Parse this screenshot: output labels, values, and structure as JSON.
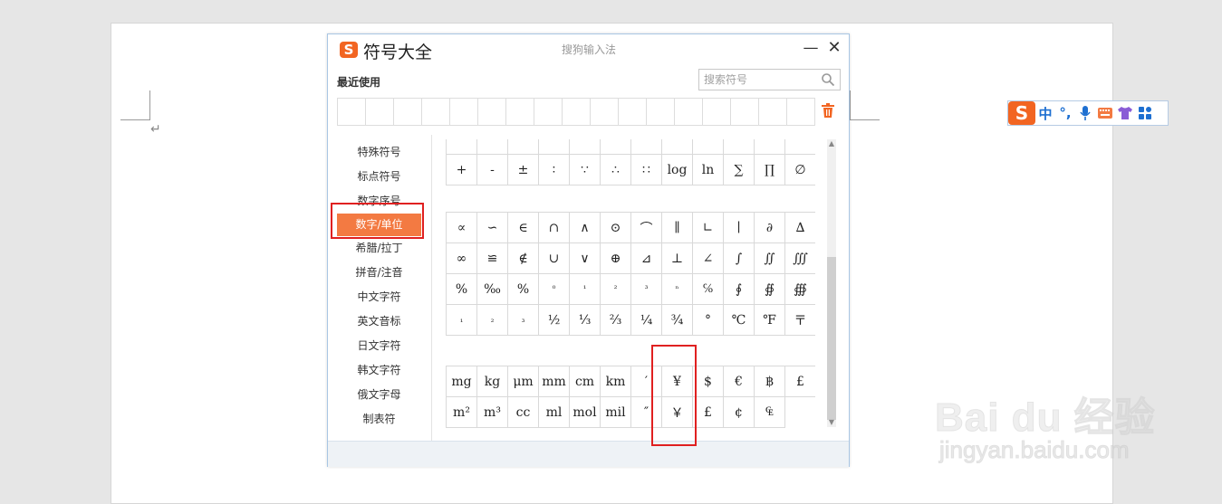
{
  "dialog": {
    "title": "符号大全",
    "subtitle": "搜狗输入法",
    "minimize": "—",
    "close": "✕",
    "recent_label": "最近使用",
    "search_placeholder": "搜索符号",
    "logo_char": "S"
  },
  "ime_bar": {
    "logo": "S",
    "items": [
      "中",
      "°,",
      "🎤",
      "⌨",
      "👕",
      "▦"
    ]
  },
  "para_mark": "↵",
  "categories": [
    "特殊符号",
    "标点符号",
    "数字序号",
    "数字/单位",
    "希腊/拉丁",
    "拼音/注音",
    "中文字符",
    "英文音标",
    "日文字符",
    "韩文字符",
    "俄文字母",
    "制表符"
  ],
  "active_category": "数字/单位",
  "grids": {
    "g0": [
      [
        "",
        "",
        "",
        "",
        "",
        "",
        "",
        "",
        "",
        "",
        "",
        ""
      ],
      [
        "+",
        "-",
        "±",
        "∶",
        "∵",
        "∴",
        "∷",
        "log",
        "ln",
        "∑",
        "∏",
        "∅"
      ]
    ],
    "g1": [
      [
        "∝",
        "∽",
        "∈",
        "∩",
        "∧",
        "⊙",
        "⌒",
        "∥",
        "∟",
        "∣",
        "∂",
        "∆"
      ],
      [
        "∞",
        "≌",
        "∉",
        "∪",
        "∨",
        "⊕",
        "⊿",
        "⊥",
        "∠",
        "∫",
        "∬",
        "∭"
      ],
      [
        "%",
        "‰",
        "%",
        "⁰",
        "¹",
        "²",
        "³",
        "ⁿ",
        "℅",
        "∮",
        "∯",
        "∰"
      ],
      [
        "₁",
        "₂",
        "₃",
        "½",
        "⅓",
        "⅔",
        "¼",
        "¾",
        "°",
        "℃",
        "℉",
        "〒"
      ]
    ],
    "g2": [
      [
        "mg",
        "kg",
        "μm",
        "mm",
        "cm",
        "km",
        "′",
        "¥",
        "$",
        "€",
        "฿",
        "£"
      ],
      [
        "m²",
        "m³",
        "cc",
        "ml",
        "mol",
        "mil",
        "″",
        "￥",
        "£",
        "¢",
        "₠",
        ""
      ]
    ]
  },
  "watermark": {
    "brand": "Bai  du 经验",
    "url": "jingyan.baidu.com"
  }
}
